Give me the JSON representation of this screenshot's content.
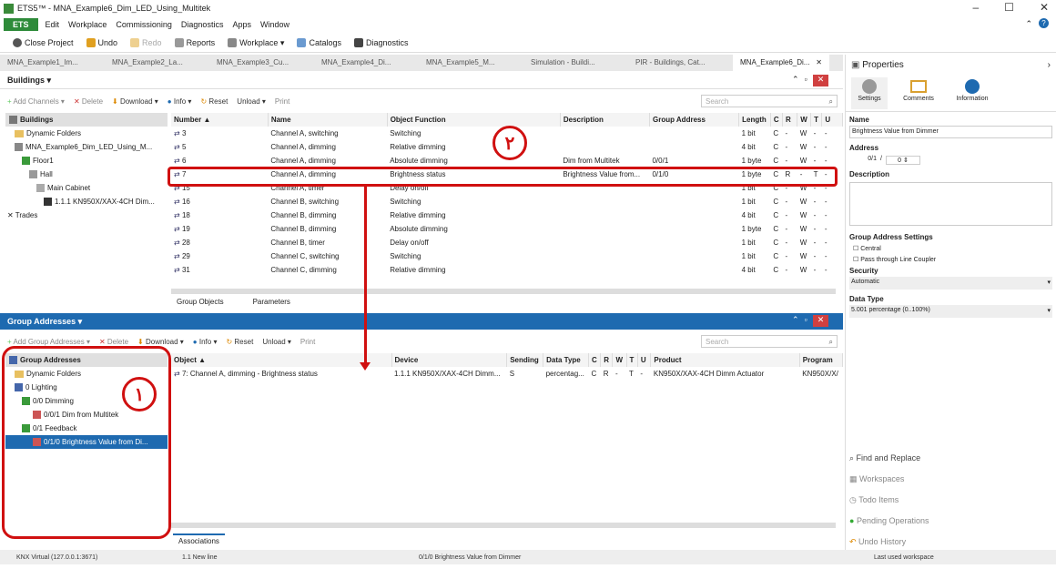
{
  "window": {
    "title": "ETS5™ - MNA_Example6_Dim_LED_Using_Multitek",
    "controls": [
      "–",
      "☐",
      "✕"
    ]
  },
  "menu": {
    "ets": "ETS",
    "items": [
      "Edit",
      "Workplace",
      "Commissioning",
      "Diagnostics",
      "Apps",
      "Window"
    ]
  },
  "toolbar": {
    "items": [
      "Close Project",
      "Undo",
      "Redo",
      "Reports",
      "Workplace ▾",
      "Catalogs",
      "Diagnostics"
    ]
  },
  "tabs": [
    "MNA_Example1_Im...",
    "MNA_Example2_La...",
    "MNA_Example3_Cu...",
    "MNA_Example4_Di...",
    "MNA_Example5_M...",
    "Simulation - Buildi...",
    "PIR - Buildings, Cat...",
    "MNA_Example6_Di..."
  ],
  "buildings": {
    "header": "Buildings ▾",
    "toolbar": [
      "Add Channels ▾",
      "Delete",
      "Download ▾",
      "Info ▾",
      "Reset",
      "Unload ▾",
      "Print"
    ],
    "search": "Search",
    "tree_header": "Buildings",
    "tree": [
      "Dynamic Folders",
      "MNA_Example6_Dim_LED_Using_M...",
      "Floor1",
      "Hall",
      "Main Cabinet",
      "1.1.1 KN950X/XAX-4CH Dim...",
      "Trades"
    ],
    "columns": [
      "Number ▲",
      "Name",
      "Object Function",
      "Description",
      "Group Address",
      "Length",
      "C",
      "R",
      "W",
      "T",
      "U"
    ],
    "rows": [
      [
        "3",
        "Channel A, switching",
        "Switching",
        "",
        "",
        "1 bit",
        "C",
        "-",
        "W",
        "-",
        "-"
      ],
      [
        "5",
        "Channel A, dimming",
        "Relative dimming",
        "",
        "",
        "4 bit",
        "C",
        "-",
        "W",
        "-",
        "-"
      ],
      [
        "6",
        "Channel A, dimming",
        "Absolute dimming",
        "Dim from Multitek",
        "0/0/1",
        "1 byte",
        "C",
        "-",
        "W",
        "-",
        "-"
      ],
      [
        "7",
        "Channel A, dimming",
        "Brightness status",
        "Brightness Value from...",
        "0/1/0",
        "1 byte",
        "C",
        "R",
        "-",
        "T",
        "-"
      ],
      [
        "15",
        "Channel A, timer",
        "Delay on/off",
        "",
        "",
        "1 bit",
        "C",
        "-",
        "W",
        "-",
        "-"
      ],
      [
        "16",
        "Channel B, switching",
        "Switching",
        "",
        "",
        "1 bit",
        "C",
        "-",
        "W",
        "-",
        "-"
      ],
      [
        "18",
        "Channel B, dimming",
        "Relative dimming",
        "",
        "",
        "4 bit",
        "C",
        "-",
        "W",
        "-",
        "-"
      ],
      [
        "19",
        "Channel B, dimming",
        "Absolute dimming",
        "",
        "",
        "1 byte",
        "C",
        "-",
        "W",
        "-",
        "-"
      ],
      [
        "28",
        "Channel B, timer",
        "Delay on/off",
        "",
        "",
        "1 bit",
        "C",
        "-",
        "W",
        "-",
        "-"
      ],
      [
        "29",
        "Channel C, switching",
        "Switching",
        "",
        "",
        "1 bit",
        "C",
        "-",
        "W",
        "-",
        "-"
      ],
      [
        "31",
        "Channel C, dimming",
        "Relative dimming",
        "",
        "",
        "4 bit",
        "C",
        "-",
        "W",
        "-",
        "-"
      ]
    ],
    "subtabs": [
      "Group Objects",
      "Parameters"
    ]
  },
  "group_addresses": {
    "header": "Group Addresses ▾",
    "toolbar": [
      "Add Group Addresses ▾",
      "Delete",
      "Download ▾",
      "Info ▾",
      "Reset",
      "Unload ▾",
      "Print"
    ],
    "search": "Search",
    "tree_header": "Group Addresses",
    "tree": [
      "Dynamic Folders",
      "0 Lighting",
      "0/0 Dimming",
      "0/0/1 Dim from Multitek",
      "0/1 Feedback",
      "0/1/0 Brightness Value from Di..."
    ],
    "columns": [
      "Object ▲",
      "Device",
      "Sending",
      "Data Type",
      "C",
      "R",
      "W",
      "T",
      "U",
      "Product",
      "Program"
    ],
    "rows": [
      [
        "7: Channel A, dimming - Brightness status",
        "1.1.1 KN950X/XAX-4CH Dimm...",
        "S",
        "percentag...",
        "C",
        "R",
        "-",
        "T",
        "-",
        "KN950X/XAX-4CH Dimm Actuator",
        "KN950X/X/"
      ]
    ],
    "subtabs": [
      "Associations"
    ]
  },
  "properties": {
    "title": "Properties",
    "tabs": [
      "Settings",
      "Comments",
      "Information"
    ],
    "name_label": "Name",
    "name_value": "Brightness Value from Dimmer",
    "address_label": "Address",
    "address_value": "0/1",
    "address_sep": "/",
    "address_sub": "0",
    "description_label": "Description",
    "gas_label": "Group Address Settings",
    "central": "Central",
    "pass": "Pass through Line Coupler",
    "security_label": "Security",
    "security_value": "Automatic",
    "datatype_label": "Data Type",
    "datatype_value": "5.001 percentage (0..100%)",
    "links": [
      "Find and Replace",
      "Workspaces",
      "Todo Items",
      "Pending Operations",
      "Undo History"
    ]
  },
  "status": {
    "connection": "KNX Virtual  (127.0.0.1:3671)",
    "line": "1.1 New line",
    "selection": "0/1/0 Brightness Value from Dimmer",
    "workspace": "Last used workspace"
  },
  "annotations": {
    "one": "۱",
    "two": "۲"
  }
}
